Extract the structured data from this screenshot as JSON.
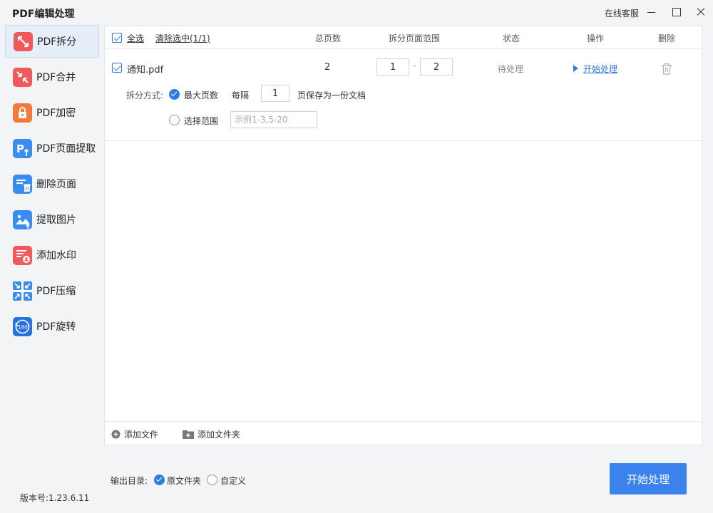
{
  "app": {
    "title": "PDF编辑处理",
    "support": "在线客服"
  },
  "sidebar": {
    "items": [
      {
        "label": "PDF拆分",
        "icon": "split-pdf-icon",
        "color": "#f05a5a",
        "active": true
      },
      {
        "label": "PDF合并",
        "icon": "merge-pdf-icon",
        "color": "#f05a5a"
      },
      {
        "label": "PDF加密",
        "icon": "lock-pdf-icon",
        "color": "#f47a3c"
      },
      {
        "label": "PDF页面提取",
        "icon": "extract-page-icon",
        "color": "#3a8cf0"
      },
      {
        "label": "删除页面",
        "icon": "delete-page-icon",
        "color": "#3a8cf0"
      },
      {
        "label": "提取图片",
        "icon": "extract-image-icon",
        "color": "#3a8cf0"
      },
      {
        "label": "添加水印",
        "icon": "watermark-icon",
        "color": "#f05a5a"
      },
      {
        "label": "PDF压缩",
        "icon": "compress-pdf-icon",
        "color": "#3a8cf0"
      },
      {
        "label": "PDF旋转",
        "icon": "rotate-pdf-icon",
        "color": "#2872e0",
        "badge": "180°"
      }
    ]
  },
  "version": "版本号:1.23.6.11",
  "table": {
    "select_all": "全选",
    "clear_selection": "清除选中(1/1)",
    "headers": {
      "total_pages": "总页数",
      "range": "拆分页面范围",
      "status": "状态",
      "action": "操作",
      "delete": "删除"
    },
    "rows": [
      {
        "filename": "通知.pdf",
        "total_pages": "2",
        "range_from": "1",
        "range_sep": "-",
        "range_to": "2",
        "status": "待处理",
        "action": "开始处理",
        "split": {
          "label": "拆分方式:",
          "option_max": "最大页数",
          "every": "每隔",
          "every_value": "1",
          "suffix": "页保存为一份文档",
          "option_range": "选择范围",
          "range_placeholder": "示例1-3,5-20"
        }
      }
    ]
  },
  "footer": {
    "add_file": "添加文件",
    "add_folder": "添加文件夹"
  },
  "output": {
    "label": "输出目录:",
    "opt_original": "原文件夹",
    "opt_custom": "自定义"
  },
  "start_button": "开始处理",
  "colors": {
    "accent": "#2f7ae5",
    "primary_button": "#3b82ec"
  }
}
